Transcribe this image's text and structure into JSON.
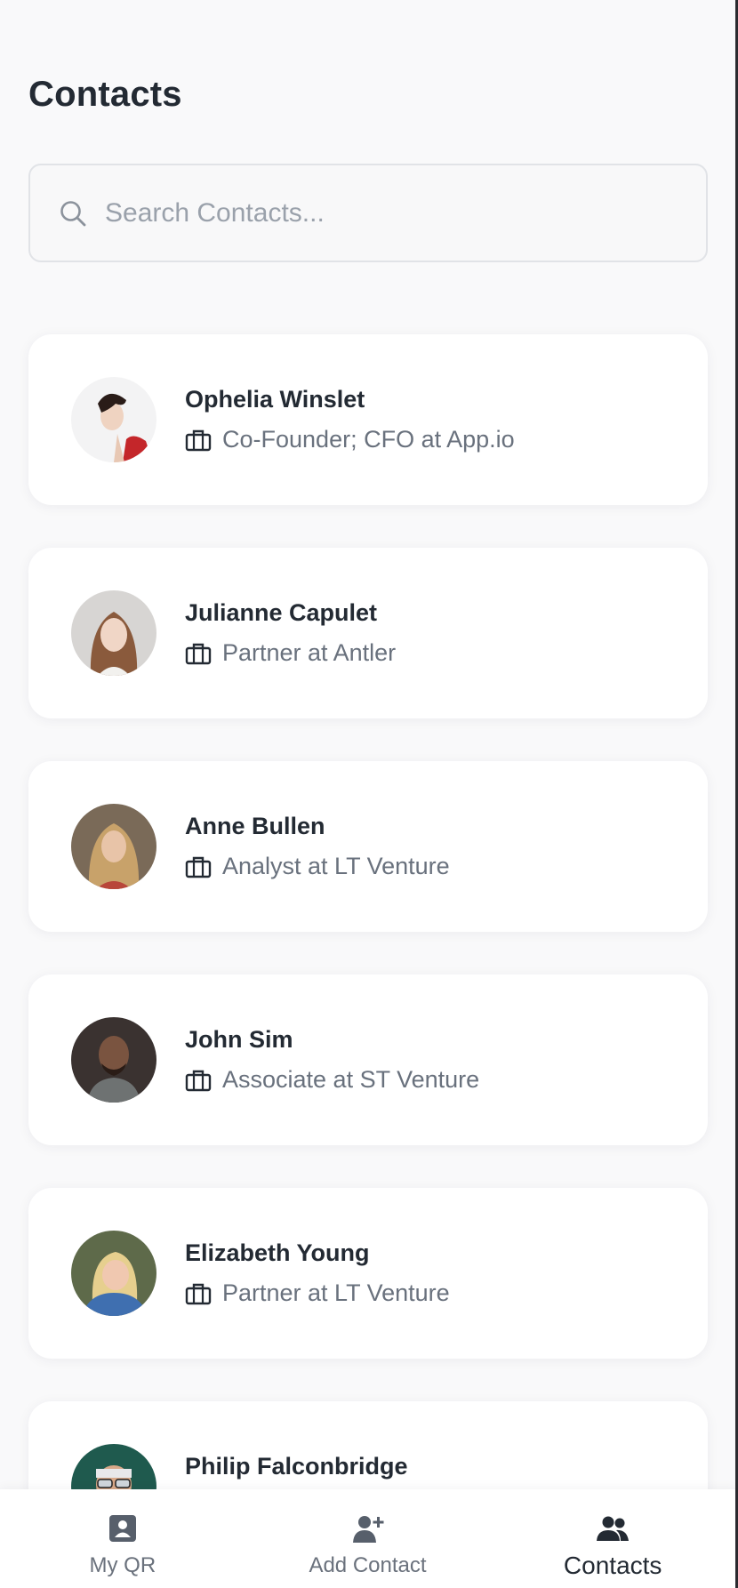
{
  "header": {
    "title": "Contacts"
  },
  "search": {
    "placeholder": "Search Contacts...",
    "value": ""
  },
  "contacts": [
    {
      "name": "Ophelia Winslet",
      "role": "Co-Founder; CFO at App.io"
    },
    {
      "name": "Julianne Capulet",
      "role": "Partner at Antler"
    },
    {
      "name": "Anne Bullen",
      "role": "Analyst at LT Venture"
    },
    {
      "name": "John Sim",
      "role": "Associate at ST Venture"
    },
    {
      "name": "Elizabeth Young",
      "role": "Partner at LT Venture"
    },
    {
      "name": "Philip Falconbridge",
      "role": ""
    }
  ],
  "nav": {
    "items": [
      {
        "label": "My QR",
        "icon": "id-card-icon"
      },
      {
        "label": "Add Contact",
        "icon": "user-plus-icon"
      },
      {
        "label": "Contacts",
        "icon": "users-icon",
        "active": true
      }
    ]
  },
  "colors": {
    "background": "#f9f9fa",
    "card": "#ffffff",
    "title": "#232a33",
    "muted": "#69717d",
    "nav_inactive": "#6a717c",
    "nav_active": "#232a33"
  }
}
